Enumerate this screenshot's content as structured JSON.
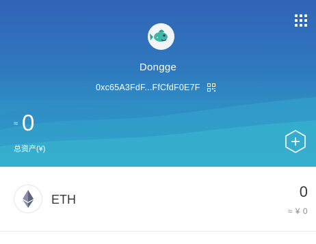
{
  "header": {
    "wallet_name": "Dongge",
    "address": "0xc65A3FdF...FfCfdF0E7F",
    "total_approx_symbol": "≈",
    "total_value": "0",
    "total_label": "总资产(¥)"
  },
  "icons": {
    "menu": "grid-dots-icon",
    "avatar": "fish-avatar",
    "qr": "qr-code-icon",
    "add": "hexagon-plus-icon",
    "token": "ethereum-icon"
  },
  "tokens": [
    {
      "symbol": "ETH",
      "balance": "0",
      "fiat": "≈ ¥ 0"
    }
  ],
  "colors": {
    "header_top": "#3163b6",
    "header_bottom": "#35b6cf",
    "text_dark": "#3a3a3a",
    "text_muted": "#8d8d8d"
  }
}
